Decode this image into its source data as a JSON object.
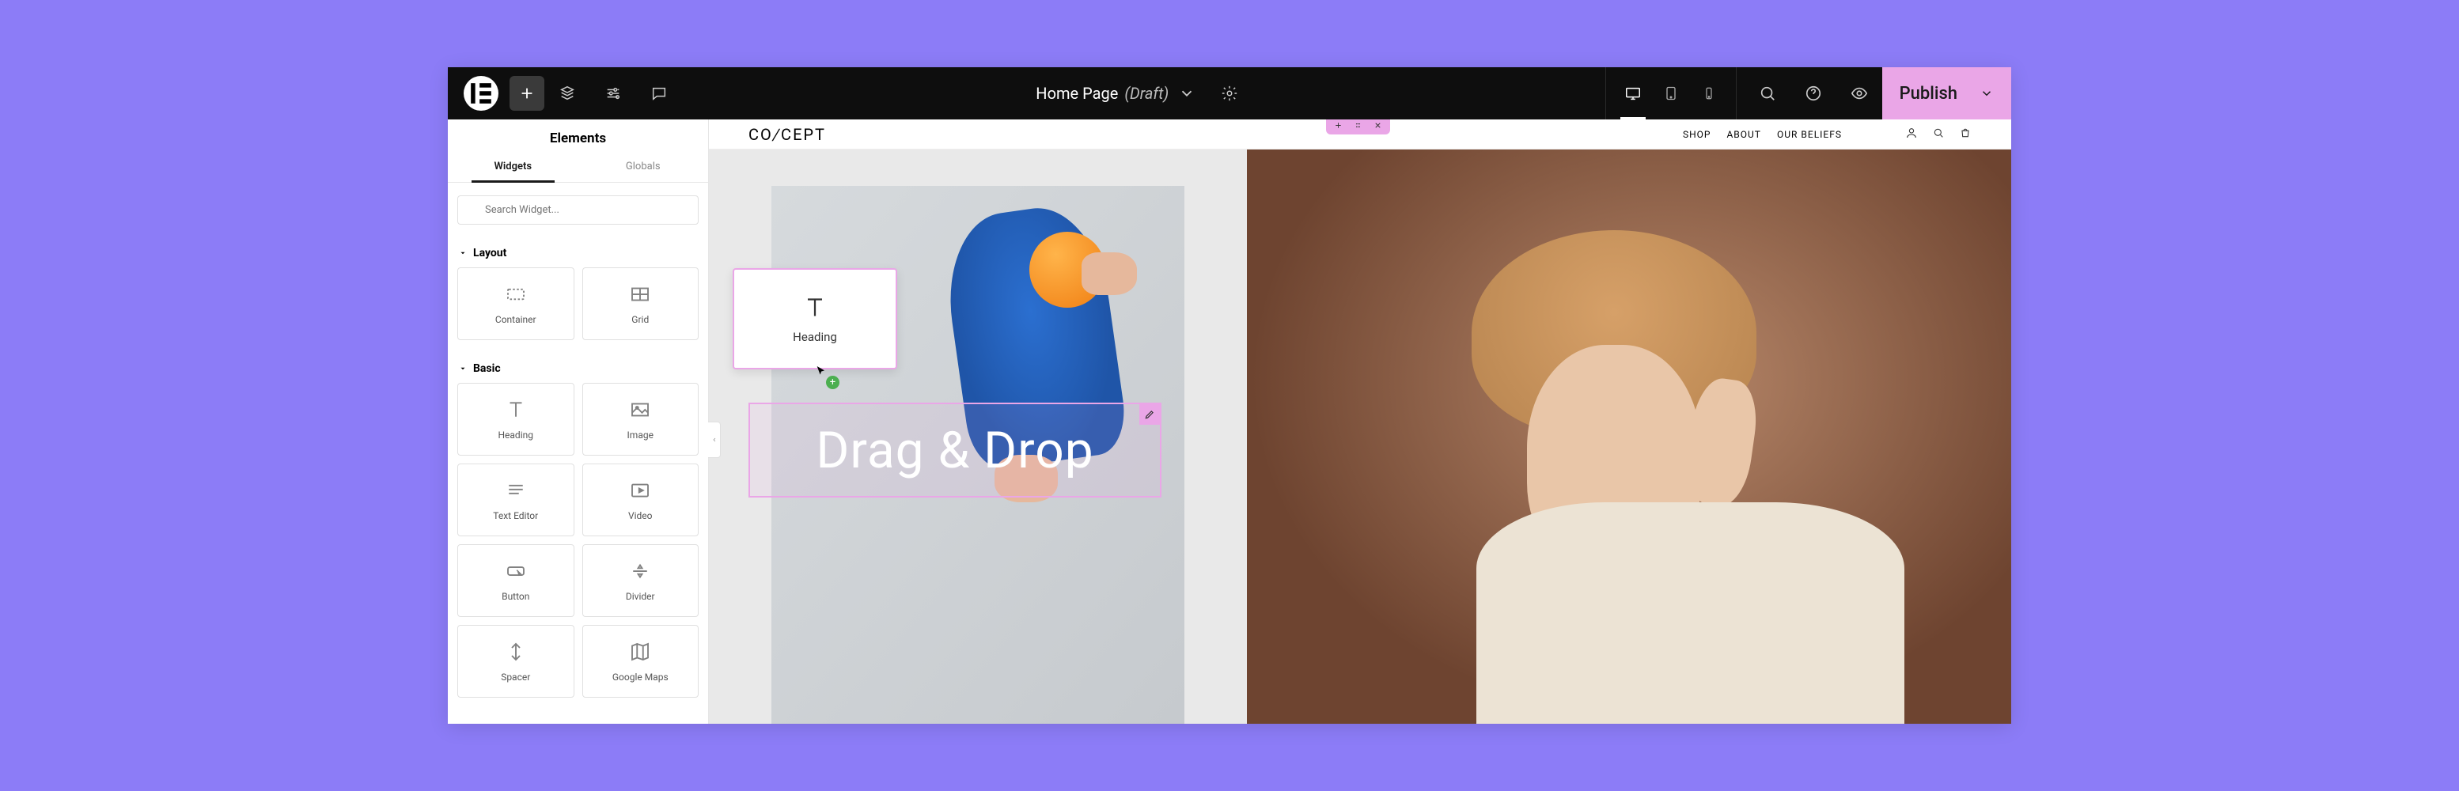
{
  "topbar": {
    "page_title": "Home Page",
    "page_status": "(Draft)",
    "publish_label": "Publish"
  },
  "sidebar": {
    "title": "Elements",
    "tabs": {
      "widgets": "Widgets",
      "globals": "Globals"
    },
    "search_placeholder": "Search Widget...",
    "sections": {
      "layout": {
        "label": "Layout",
        "items": [
          {
            "label": "Container"
          },
          {
            "label": "Grid"
          }
        ]
      },
      "basic": {
        "label": "Basic",
        "items": [
          {
            "label": "Heading"
          },
          {
            "label": "Image"
          },
          {
            "label": "Text Editor"
          },
          {
            "label": "Video"
          },
          {
            "label": "Button"
          },
          {
            "label": "Divider"
          },
          {
            "label": "Spacer"
          },
          {
            "label": "Google Maps"
          }
        ]
      }
    }
  },
  "drag_preview": {
    "label": "Heading"
  },
  "canvas": {
    "brand": "CONCEPT",
    "nav": {
      "shop": "SHOP",
      "about": "ABOUT",
      "beliefs": "OUR BELIEFS"
    },
    "drop_text": "Drag & Drop"
  }
}
